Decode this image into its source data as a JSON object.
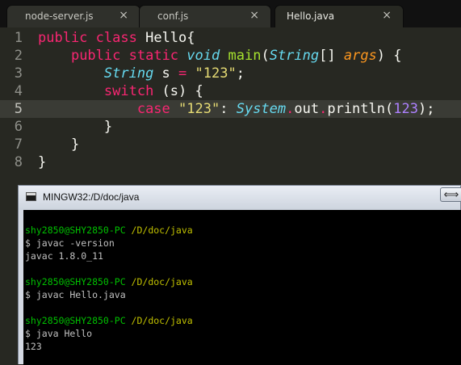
{
  "tabs": [
    {
      "label": "node-server.js",
      "close": "×",
      "active": false
    },
    {
      "label": "conf.js",
      "close": "×",
      "active": false
    },
    {
      "label": "Hello.java",
      "close": "×",
      "active": true
    }
  ],
  "editor": {
    "current_line": 5,
    "lines": [
      {
        "num": "1",
        "tokens": [
          {
            "t": "public",
            "c": "kw"
          },
          {
            "t": " ",
            "c": "pl"
          },
          {
            "t": "class",
            "c": "kw"
          },
          {
            "t": " Hello{",
            "c": "pl"
          }
        ]
      },
      {
        "num": "2",
        "tokens": [
          {
            "t": "    ",
            "c": "pl"
          },
          {
            "t": "public",
            "c": "kw"
          },
          {
            "t": " ",
            "c": "pl"
          },
          {
            "t": "static",
            "c": "kw"
          },
          {
            "t": " ",
            "c": "pl"
          },
          {
            "t": "void",
            "c": "ty"
          },
          {
            "t": " ",
            "c": "pl"
          },
          {
            "t": "main",
            "c": "fn"
          },
          {
            "t": "(",
            "c": "pl"
          },
          {
            "t": "String",
            "c": "ty"
          },
          {
            "t": "[] ",
            "c": "pl"
          },
          {
            "t": "args",
            "c": "ar"
          },
          {
            "t": ") {",
            "c": "pl"
          }
        ]
      },
      {
        "num": "3",
        "tokens": [
          {
            "t": "        ",
            "c": "pl"
          },
          {
            "t": "String",
            "c": "ty"
          },
          {
            "t": " s ",
            "c": "pl"
          },
          {
            "t": "=",
            "c": "kw"
          },
          {
            "t": " ",
            "c": "pl"
          },
          {
            "t": "\"123\"",
            "c": "st"
          },
          {
            "t": ";",
            "c": "pl"
          }
        ]
      },
      {
        "num": "4",
        "tokens": [
          {
            "t": "        ",
            "c": "pl"
          },
          {
            "t": "switch",
            "c": "kw"
          },
          {
            "t": " (s) {",
            "c": "pl"
          }
        ]
      },
      {
        "num": "5",
        "tokens": [
          {
            "t": "            ",
            "c": "pl"
          },
          {
            "t": "case",
            "c": "kw"
          },
          {
            "t": " ",
            "c": "pl"
          },
          {
            "t": "\"123\"",
            "c": "st"
          },
          {
            "t": ": ",
            "c": "pl"
          },
          {
            "t": "System",
            "c": "ty"
          },
          {
            "t": ".",
            "c": "kw"
          },
          {
            "t": "out",
            "c": "pl"
          },
          {
            "t": ".",
            "c": "kw"
          },
          {
            "t": "println",
            "c": "pl"
          },
          {
            "t": "(",
            "c": "pl"
          },
          {
            "t": "123",
            "c": "nu"
          },
          {
            "t": ");",
            "c": "pl"
          }
        ]
      },
      {
        "num": "6",
        "tokens": [
          {
            "t": "        }",
            "c": "pl"
          }
        ]
      },
      {
        "num": "7",
        "tokens": [
          {
            "t": "    }",
            "c": "pl"
          }
        ]
      },
      {
        "num": "8",
        "tokens": [
          {
            "t": "}",
            "c": "pl"
          }
        ]
      }
    ]
  },
  "terminal": {
    "title": "MINGW32:/D/doc/java",
    "resize_glyph": "⟺",
    "lines": [
      {
        "text": ""
      },
      {
        "user": "shy2850@SHY2850-PC",
        "path": " /D/doc/java"
      },
      {
        "text": "$ javac -version"
      },
      {
        "text": "javac 1.8.0_11"
      },
      {
        "text": ""
      },
      {
        "user": "shy2850@SHY2850-PC",
        "path": " /D/doc/java"
      },
      {
        "text": "$ javac Hello.java"
      },
      {
        "text": ""
      },
      {
        "user": "shy2850@SHY2850-PC",
        "path": " /D/doc/java"
      },
      {
        "text": "$ java Hello"
      },
      {
        "text": "123"
      }
    ]
  },
  "colors": {
    "editor_bg": "#272822",
    "keyword": "#f92672",
    "type": "#66d9ef",
    "string": "#e6db74",
    "number": "#ae81ff",
    "function": "#a6e22e",
    "terminal_user": "#00c000",
    "terminal_path": "#c0c000"
  }
}
